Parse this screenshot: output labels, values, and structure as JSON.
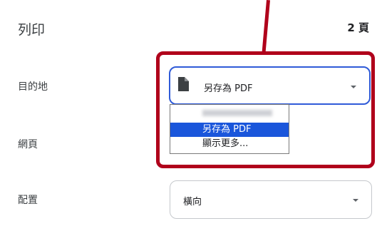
{
  "header": {
    "title": "列印",
    "page_count": "2 頁"
  },
  "rows": {
    "destination_label": "目的地",
    "pages_label": "網頁",
    "layout_label": "配置"
  },
  "destination": {
    "value": "另存為 PDF",
    "icon": "document-icon",
    "options": [
      {
        "label": "FX ApeosPort-II C3000 (…)"
      },
      {
        "label": "另存為 PDF",
        "selected": true
      },
      {
        "label": "顯示更多..."
      }
    ]
  },
  "layout": {
    "value": "橫向"
  },
  "annotation": {
    "color": "#b0001b"
  }
}
